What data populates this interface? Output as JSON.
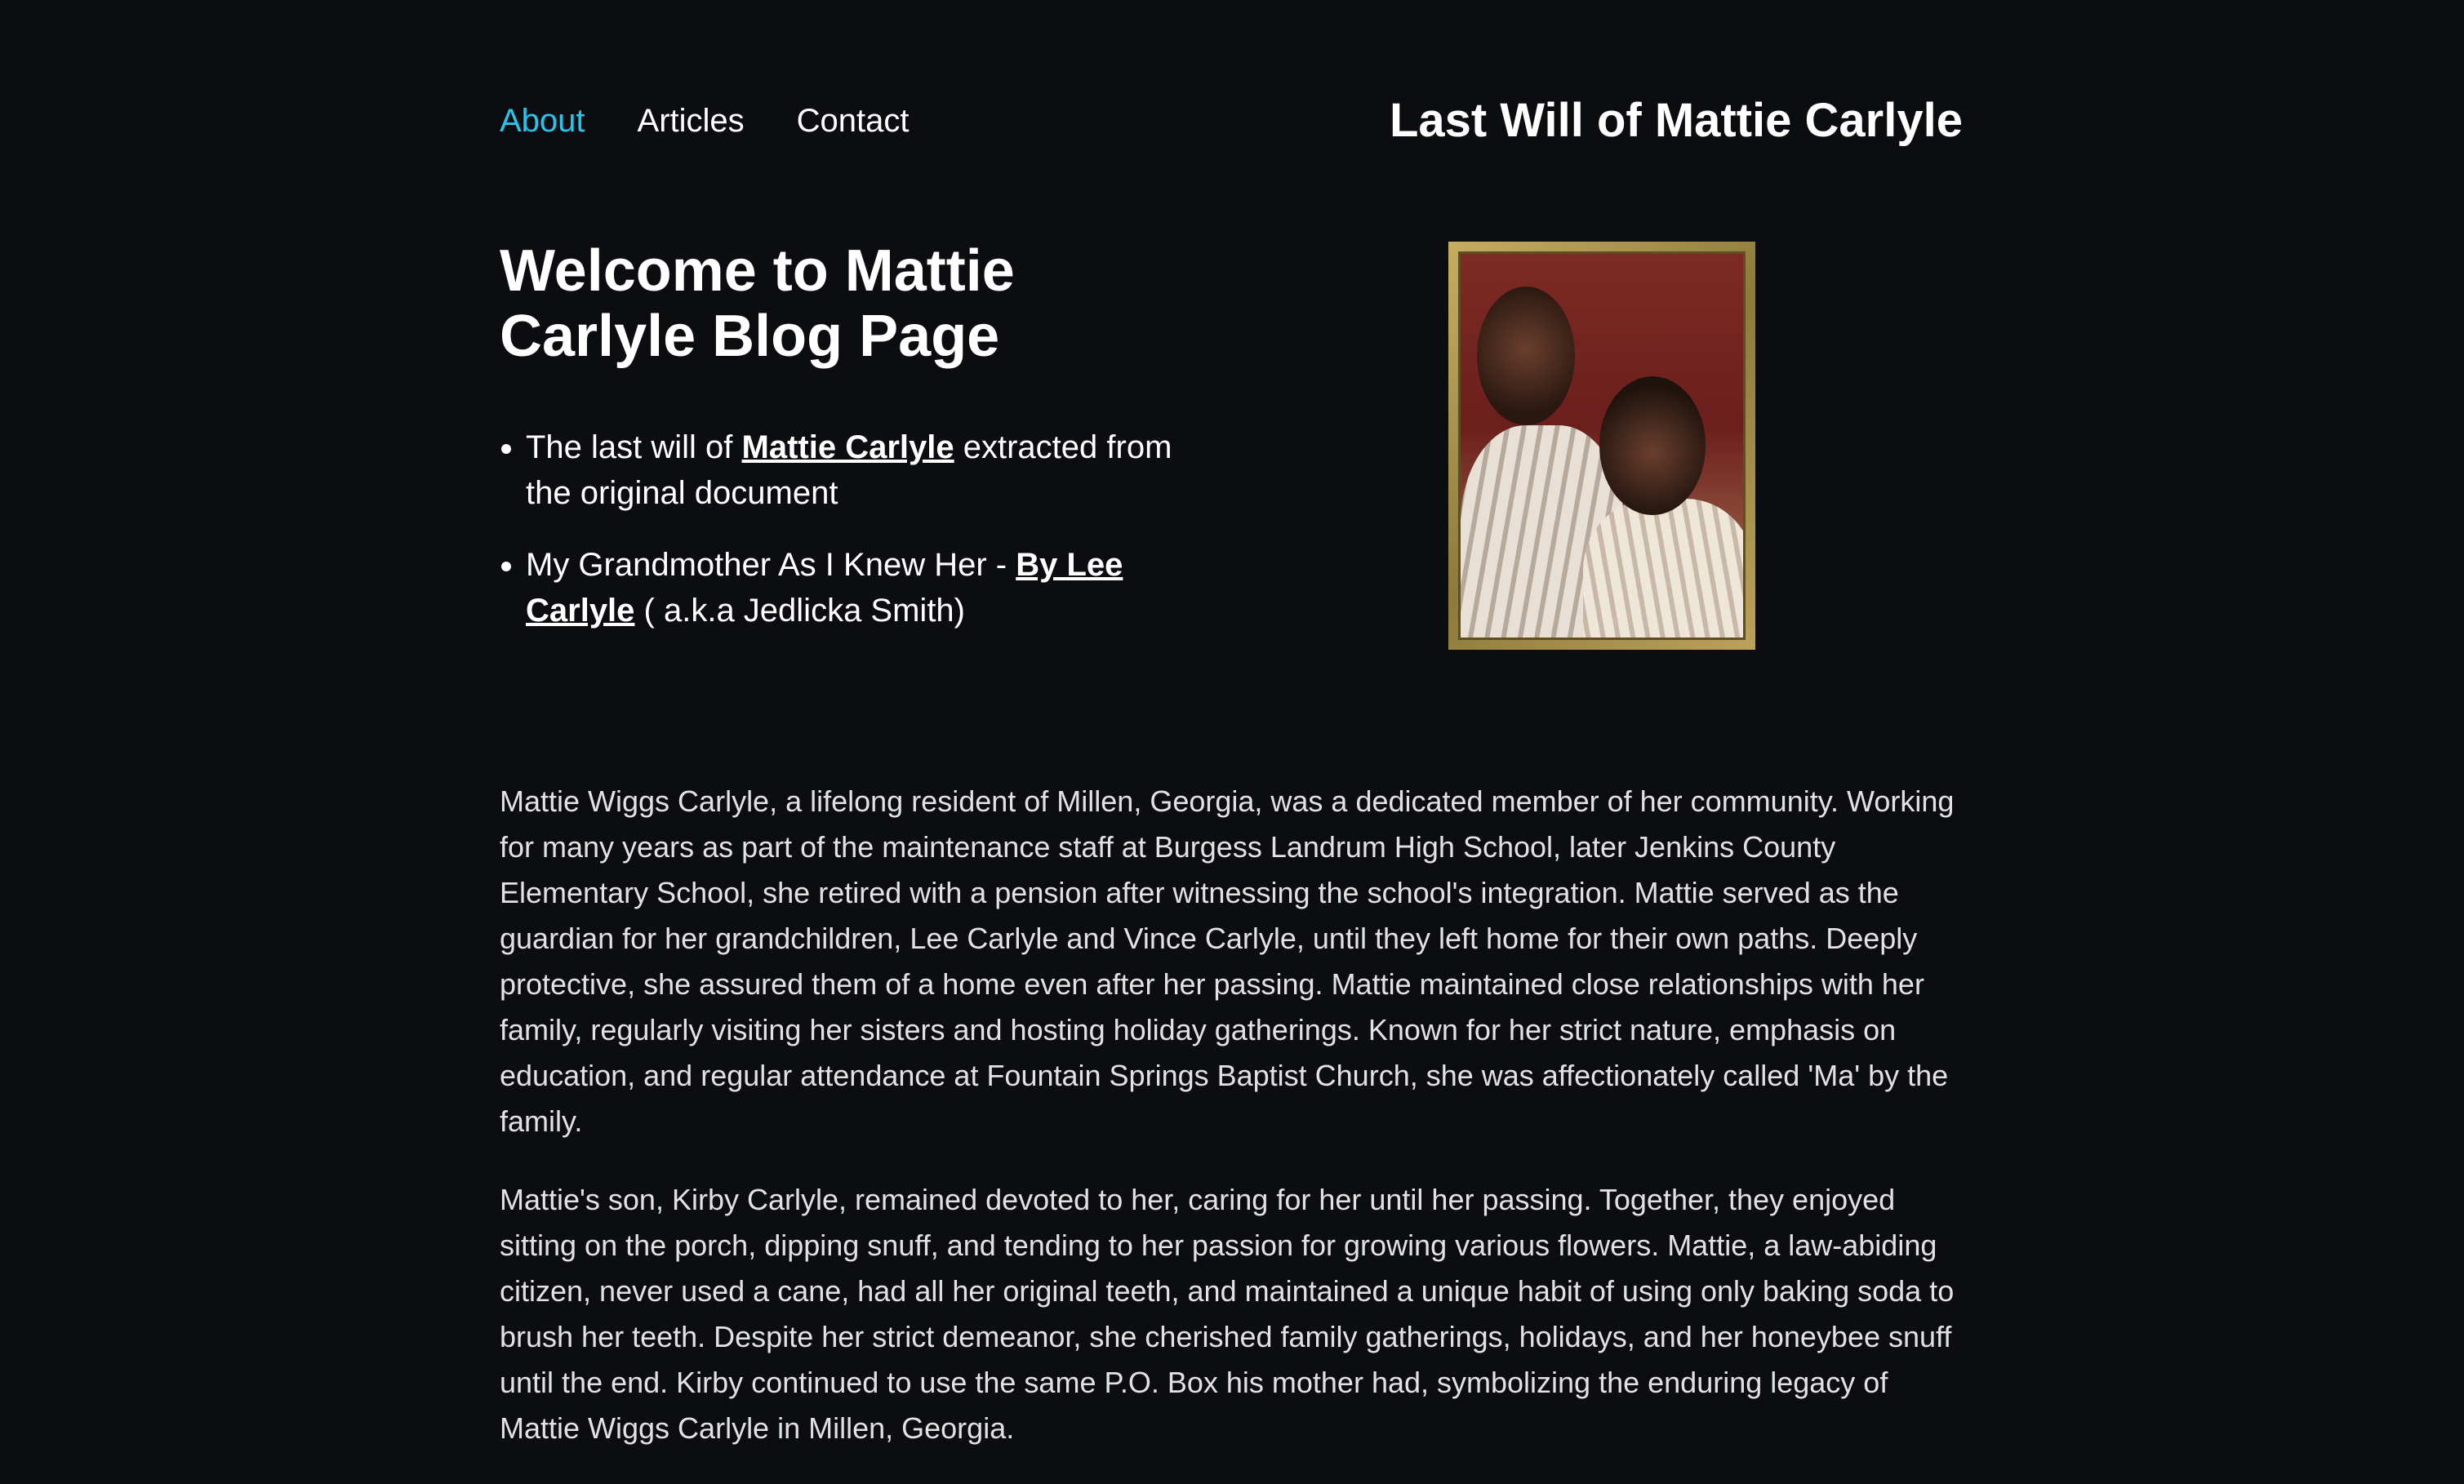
{
  "nav": {
    "items": [
      "About",
      "Articles",
      "Contact"
    ],
    "active_index": 0
  },
  "header": {
    "site_title": "Last Will of Mattie Carlyle"
  },
  "hero": {
    "heading": "Welcome to Mattie Carlyle Blog Page",
    "links": [
      {
        "before": "The last will of ",
        "link_text": "Mattie Carlyle",
        "after": " extracted from the original document"
      },
      {
        "before": "My Grandmother As I Knew Her - ",
        "link_text": "By Lee Carlyle",
        "after": " ( a.k.a Jedlicka Smith)"
      }
    ],
    "photo": "framed-family-photo"
  },
  "article": {
    "paragraphs": [
      "Mattie Wiggs Carlyle, a lifelong resident of Millen, Georgia, was a dedicated member of her community. Working for many years as part of the maintenance staff at Burgess Landrum High School, later Jenkins County Elementary School, she retired with a pension after witnessing the school's integration. Mattie served as the guardian for her grandchildren, Lee Carlyle and Vince Carlyle, until they left home for their own paths. Deeply protective, she assured them of a home even after her passing. Mattie maintained close relationships with her family, regularly visiting her sisters and hosting holiday gatherings. Known for her strict nature, emphasis on education, and regular attendance at Fountain Springs Baptist Church, she was affectionately called 'Ma' by the family.",
      "Mattie's son, Kirby Carlyle, remained devoted to her, caring for her until her passing. Together, they enjoyed sitting on the porch, dipping snuff, and tending to her passion for growing various flowers. Mattie, a law-abiding citizen, never used a cane, had all her original teeth, and maintained a unique habit of using only baking soda to brush her teeth. Despite her strict demeanor, she cherished family gatherings, holidays, and her honeybee snuff until the end. Kirby continued to use the same P.O. Box his mother had, symbolizing the enduring legacy of Mattie Wiggs Carlyle in Millen, Georgia."
    ]
  },
  "colors": {
    "background": "#0c0d10",
    "accent": "#27c4ee",
    "text": "#ffffff",
    "body_text": "#e2e2e2"
  }
}
